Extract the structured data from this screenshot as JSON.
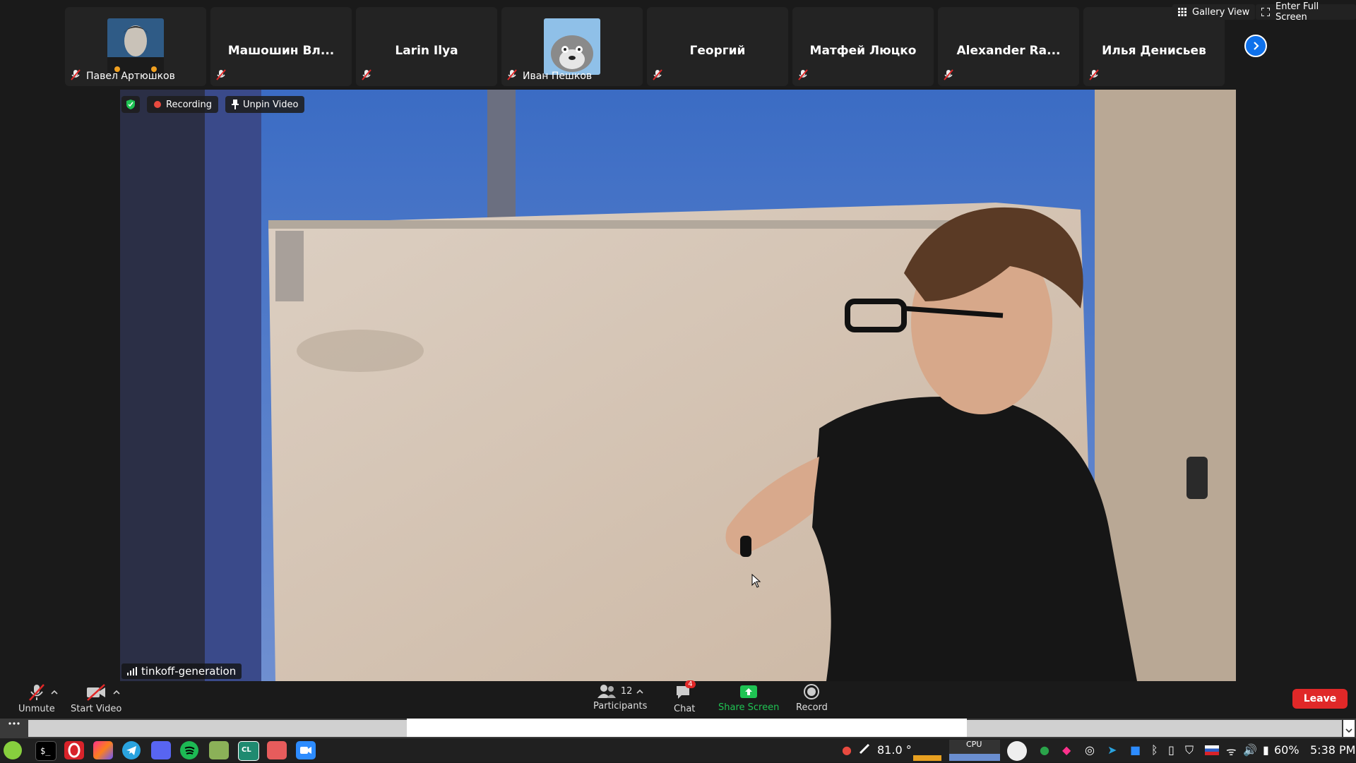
{
  "top_bar": {
    "gallery_view": "Gallery View",
    "full_screen": "Enter Full Screen"
  },
  "participants": [
    {
      "name": "Павел Артюшков",
      "label": "Павел Артюшков",
      "has_avatar": true
    },
    {
      "name": "Машошин Вл...",
      "label": "",
      "has_avatar": false
    },
    {
      "name": "Larin Ilya",
      "label": "",
      "has_avatar": false
    },
    {
      "name": "Иван Пешков",
      "label": "Иван Пешков",
      "has_avatar": true
    },
    {
      "name": "Георгий",
      "label": "",
      "has_avatar": false
    },
    {
      "name": "Матфей Люцко",
      "label": "",
      "has_avatar": false
    },
    {
      "name": "Alexander Ra...",
      "label": "",
      "has_avatar": false
    },
    {
      "name": "Илья Денисьев",
      "label": "",
      "has_avatar": false
    }
  ],
  "video": {
    "recording": "Recording",
    "unpin": "Unpin Video",
    "speaker": "tinkoff-generation"
  },
  "toolbar": {
    "unmute": "Unmute",
    "start_video": "Start Video",
    "participants": "Participants",
    "participants_count": "12",
    "chat": "Chat",
    "chat_badge": "4",
    "share_screen": "Share Screen",
    "record": "Record",
    "leave": "Leave"
  },
  "taskbar": {
    "temperature": "81.0 °",
    "cpu": "CPU",
    "battery": "60%",
    "time": "5:38 PM"
  },
  "colors": {
    "zoom_blue": "#0e71eb",
    "leave_red": "#e02828",
    "share_green": "#1fc353",
    "mute_red": "#e02828"
  }
}
